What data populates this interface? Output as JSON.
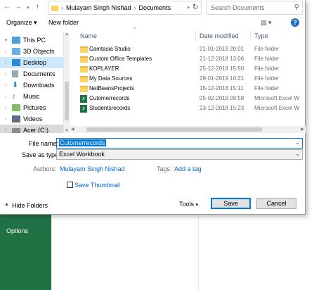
{
  "address": {
    "segments": [
      "Mulayam Singh Nishad",
      "Documents"
    ],
    "search_placeholder": "Search Documents"
  },
  "toolbar": {
    "organize_label": "Organize ▾",
    "new_folder_label": "New folder"
  },
  "nav_pane": {
    "items": [
      {
        "label": "This PC",
        "icon": "computer-icon"
      },
      {
        "label": "3D Objects",
        "icon": "3d-objects-icon"
      },
      {
        "label": "Desktop",
        "icon": "desktop-icon"
      },
      {
        "label": "Documents",
        "icon": "documents-icon"
      },
      {
        "label": "Downloads",
        "icon": "downloads-icon"
      },
      {
        "label": "Music",
        "icon": "music-icon"
      },
      {
        "label": "Pictures",
        "icon": "pictures-icon"
      },
      {
        "label": "Videos",
        "icon": "videos-icon"
      },
      {
        "label": "Acer (C:)",
        "icon": "drive-icon"
      }
    ]
  },
  "file_list": {
    "headers": {
      "name": "Name",
      "date": "Date modified",
      "type": "Type"
    },
    "rows": [
      {
        "name": "Camtasia Studio",
        "date": "21-01-2019 20:01",
        "type": "File folder",
        "icon": "folder-icon"
      },
      {
        "name": "Custom Office Templates",
        "date": "21-12-2018 13:06",
        "type": "File folder",
        "icon": "folder-icon"
      },
      {
        "name": "KOPLAYER",
        "date": "25-12-2018 15:50",
        "type": "File folder",
        "icon": "folder-icon"
      },
      {
        "name": "My Data Sources",
        "date": "28-01-2019 10:21",
        "type": "File folder",
        "icon": "folder-icon"
      },
      {
        "name": "NetBeansProjects",
        "date": "15-12-2018 15:11",
        "type": "File folder",
        "icon": "folder-icon"
      },
      {
        "name": "Cutomerrecords",
        "date": "05-02-2019 09:58",
        "type": "Microsoft Excel W",
        "icon": "excel-icon"
      },
      {
        "name": "Studentsrecords",
        "date": "23-12-2018 15:23",
        "type": "Microsoft Excel W",
        "icon": "excel-icon"
      }
    ]
  },
  "form": {
    "file_name_label": "File name:",
    "file_name_value": "Cutomerrecords",
    "save_as_label": "Save as type:",
    "save_as_value": "Excel Workbook",
    "authors_label": "Authors:",
    "authors_value": "Mulayam Singh Nishad",
    "tags_label": "Tags:",
    "tags_value": "Add a tag",
    "thumbnail_label": "Save Thumbnail"
  },
  "footer": {
    "hide_folders": "Hide Folders",
    "tools": "Tools",
    "save": "Save",
    "cancel": "Cancel"
  },
  "background": {
    "options_label": "Options"
  }
}
